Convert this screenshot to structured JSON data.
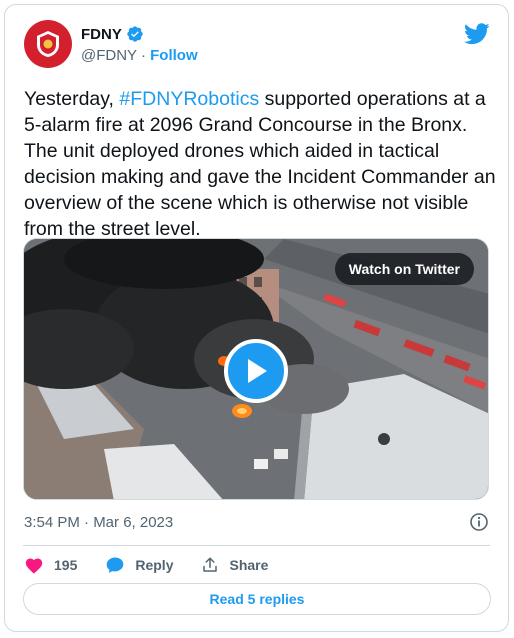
{
  "author": {
    "name": "FDNY",
    "handle": "@FDNY",
    "separator": " · ",
    "follow_label": "Follow",
    "verified": true
  },
  "tweet": {
    "text_before": "Yesterday, ",
    "hashtag": "#FDNYRobotics",
    "text_after": " supported operations at a 5-alarm fire at 2096 Grand Concourse in the Bronx. The unit deployed drones which aided in tactical decision making and gave the Incident Commander an overview of the scene which is otherwise not visible from the street level."
  },
  "media": {
    "watch_label": "Watch on Twitter"
  },
  "timestamp": "3:54 PM · Mar 6, 2023",
  "actions": {
    "like_count": "195",
    "reply_label": "Reply",
    "share_label": "Share"
  },
  "read_replies_label": "Read 5 replies",
  "colors": {
    "accent": "#1d9bf0",
    "like": "#f91880",
    "brand_red": "#d3202f"
  }
}
